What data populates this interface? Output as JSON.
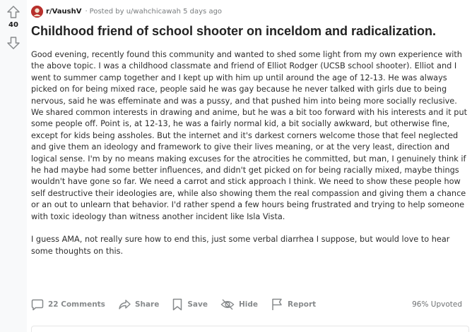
{
  "vote": {
    "count": "40"
  },
  "meta": {
    "subreddit": "r/VaushV",
    "separator": "·",
    "posted_by": "Posted by u/wahchicawah 5 days ago"
  },
  "post": {
    "title": "Childhood friend of school shooter on inceldom and radicalization.",
    "paragraphs": [
      "Good evening, recently found this community and wanted to shed some light from my own experience with the above topic. I was a childhood classmate and friend of Elliot Rodger (UCSB school shooter). Elliot and I went to summer camp together and I kept up with him up until around the age of 12-13. He was always picked on for being mixed race, people said he was gay because he never talked with girls due to being nervous, said he was effeminate and was a pussy, and that pushed him into being more socially reclusive. We shared common interests in drawing and anime, but he was a bit too forward with his interests and it put some people off. Point is, at 12-13, he was a fairly normal kid, a bit socially awkward, but otherwise fine, except for kids being assholes. But the internet and it's darkest corners welcome those that feel neglected and give them an ideology and framework to give their lives meaning, or at the very least, direction and logical sense. I'm by no means making excuses for the atrocities he committed, but man, I genuinely think if he had maybe had some better influences, and didn't get picked on for being racially mixed, maybe things wouldn't have gone so far. We need a carrot and stick approach I think. We need to show these people how self destructive their ideologies are, while also showing them the real compassion and giving them a chance or an out to unlearn that behavior. I'd rather spend a few hours being frustrated and trying to help someone with toxic ideology than witness another incident like Isla Vista.",
      "I guess AMA, not really sure how to end this, just some verbal diarrhea I suppose, but would love to hear some thoughts on this."
    ]
  },
  "actions": {
    "comments": "22 Comments",
    "share": "Share",
    "save": "Save",
    "hide": "Hide",
    "report": "Report",
    "upvoted": "96% Upvoted"
  },
  "colors": {
    "vote_column_bg": "#f8f9fa",
    "meta_text": "#787c7e",
    "action_text": "#878a8c",
    "subreddit_avatar": "#b8302c"
  },
  "icons": {
    "upvote": "arrow-up-icon",
    "downvote": "arrow-down-icon",
    "comments": "comment-bubble-icon",
    "share": "share-arrow-icon",
    "save": "bookmark-icon",
    "hide": "eye-slash-icon",
    "report": "flag-icon"
  }
}
